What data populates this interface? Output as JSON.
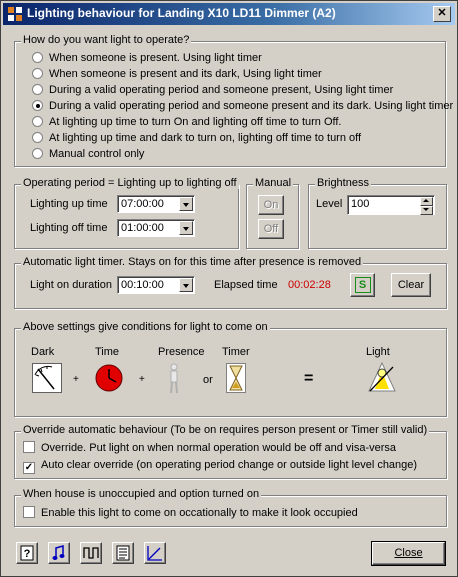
{
  "window": {
    "title": "Lighting behaviour for Landing X10 LD11 Dimmer (A2)",
    "close_glyph": "✕"
  },
  "operate_group": {
    "legend": "How do you want light to operate?",
    "options": [
      "When someone is present.  Using light timer",
      "When someone is present and its dark, Using light timer",
      "During a valid operating period and someone present,  Using light timer",
      "During a valid operating period and someone present and its dark.  Using light timer",
      "At lighting up time to turn On and lighting off time to turn Off.",
      "At lighting up time and dark to turn on, lighting off time to turn off",
      "Manual control only"
    ],
    "selected_index": 3
  },
  "operating_period": {
    "legend": "Operating period = Lighting up to lighting off",
    "up_label": "Lighting up time",
    "up_value": "07:00:00",
    "off_label": "Lighting off time",
    "off_value": "01:00:00"
  },
  "manual": {
    "legend": "Manual",
    "on_label": "On",
    "off_label": "Off"
  },
  "brightness": {
    "legend": "Brightness",
    "level_label": "Level",
    "level_value": "100"
  },
  "timer": {
    "legend": "Automatic light timer.  Stays on for this time after presence is removed",
    "duration_label": "Light on duration",
    "duration_value": "00:10:00",
    "elapsed_label": "Elapsed time",
    "elapsed_value": "00:02:28",
    "s_label": "S",
    "clear_label": "Clear"
  },
  "conditions": {
    "legend": "Above settings give conditions for light to come on",
    "dark": "Dark",
    "time": "Time",
    "presence": "Presence",
    "timer": "Timer",
    "light": "Light",
    "plus1": "+",
    "plus2": "+",
    "or": "or",
    "equals": "="
  },
  "override": {
    "legend": "Override automatic behaviour (To be on requires person present or Timer still valid)",
    "override_label": "Override.  Put light on when normal operation would be off and visa-versa",
    "override_checked": false,
    "autoclear_label": "Auto clear override (on operating period change or outside light level change)",
    "autoclear_checked": true
  },
  "unoccupied": {
    "legend": "When house is unoccupied and option turned on",
    "enable_label": "Enable this light to come on occationally to make it look occupied",
    "enable_checked": false
  },
  "footer": {
    "close_label": "Close"
  },
  "colors": {
    "elapsed": "#cc0000",
    "s_button": "#1a8c1a",
    "timer_dial": "#e00000"
  }
}
